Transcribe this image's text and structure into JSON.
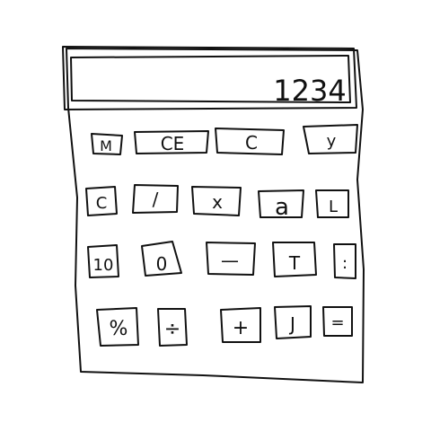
{
  "display": {
    "value": "1234"
  },
  "rows": [
    [
      {
        "id": "m",
        "label": "M"
      },
      {
        "id": "ce",
        "label": "CE"
      },
      {
        "id": "c",
        "label": "C"
      },
      {
        "id": "y",
        "label": "y"
      }
    ],
    [
      {
        "id": "c2",
        "label": "C"
      },
      {
        "id": "slash",
        "label": "/"
      },
      {
        "id": "x",
        "label": "x"
      },
      {
        "id": "a",
        "label": "a"
      },
      {
        "id": "corner",
        "label": "L"
      }
    ],
    [
      {
        "id": "10",
        "label": "10"
      },
      {
        "id": "0",
        "label": "0"
      },
      {
        "id": "minus",
        "label": "—"
      },
      {
        "id": "t",
        "label": "T"
      },
      {
        "id": "colon",
        "label": ":"
      }
    ],
    [
      {
        "id": "pct",
        "label": "%"
      },
      {
        "id": "frac",
        "label": "÷"
      },
      {
        "id": "plus",
        "label": "+"
      },
      {
        "id": "j",
        "label": "J"
      },
      {
        "id": "eq",
        "label": "="
      }
    ]
  ]
}
